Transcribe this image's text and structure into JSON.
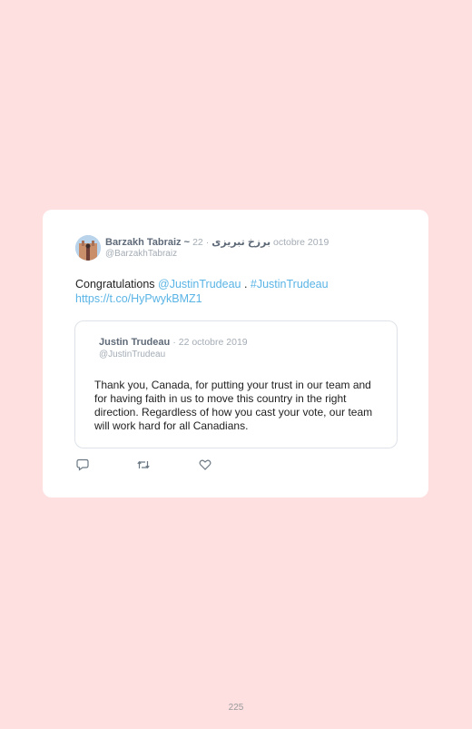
{
  "tweet": {
    "author_name": "Barzakh Tabraiz ~ برزخ تبریزی",
    "date": "22 octobre 2019",
    "handle": "@BarzakhTabraiz",
    "text_start": "Congratulations ",
    "mention": "@JustinTrudeau",
    "text_sep": " . ",
    "hashtag": "#JustinTrudeau",
    "link": "https://t.co/HyPwykBMZ1"
  },
  "quoted": {
    "author_name": "Justin Trudeau",
    "date": "22 octobre 2019",
    "handle": "@JustinTrudeau",
    "text": "Thank you, Canada, for putting your trust in our team and for having faith in us to move this country in the right direction. Regardless of how you cast your vote, our team will work hard for all Canadians."
  },
  "actions": {
    "icons": [
      "reply-icon",
      "retweet-icon",
      "like-icon"
    ]
  },
  "page": {
    "number": "225"
  },
  "colors": {
    "background": "#ffe0e1",
    "card": "#ffffff",
    "link": "#5ab4e5"
  }
}
